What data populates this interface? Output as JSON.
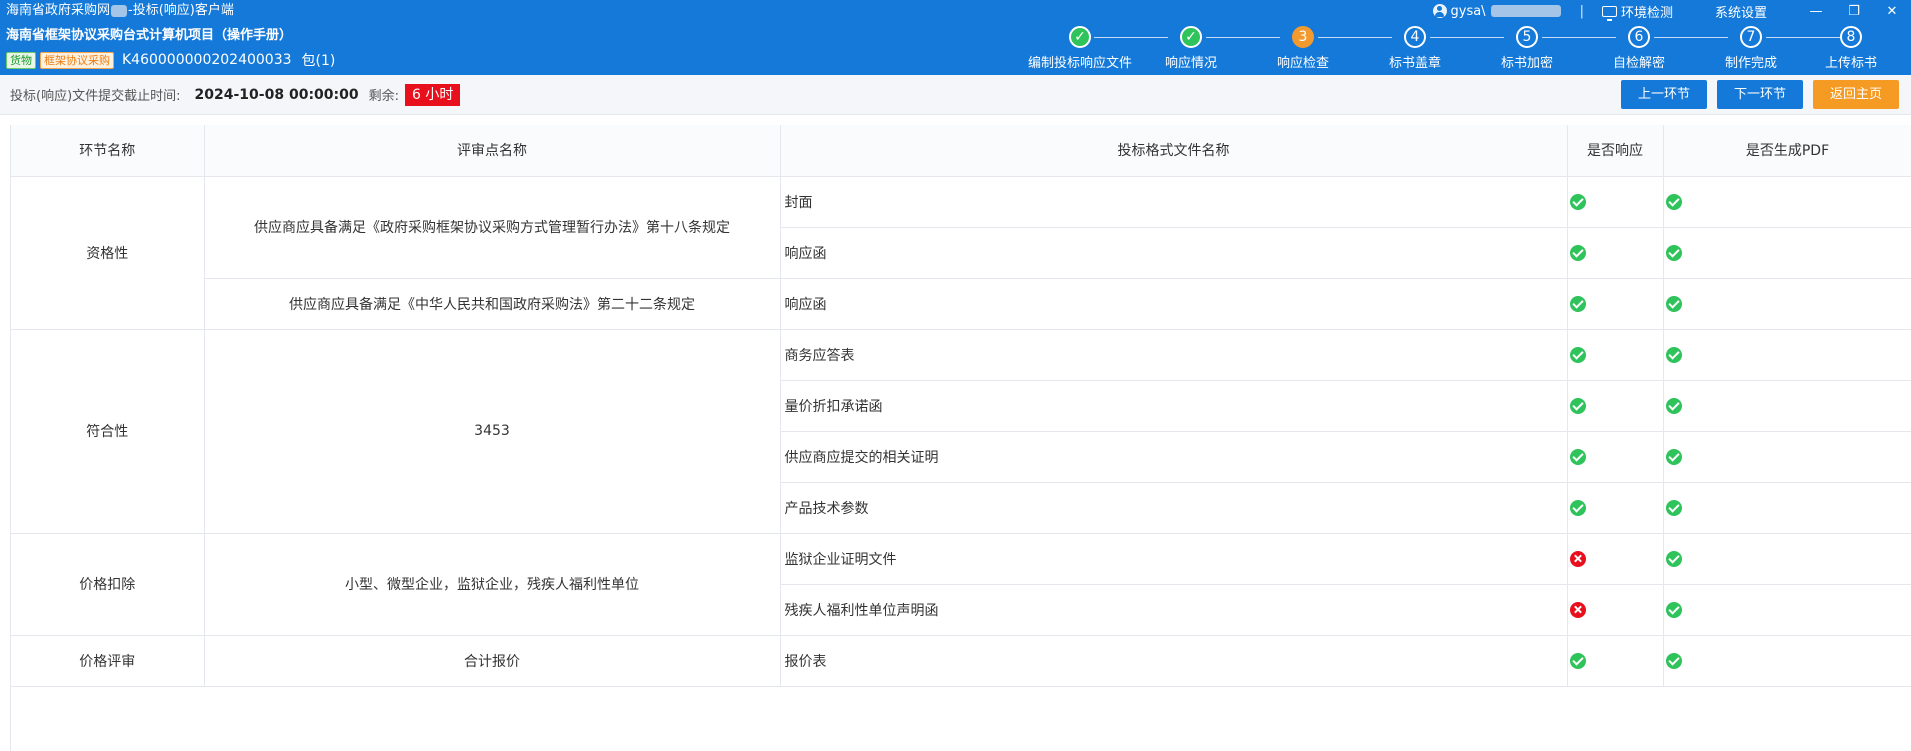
{
  "window": {
    "title_part1": "海南省政府采购网",
    "title_part2": "-投标(响应)客户端",
    "project_title": "海南省框架协议采购台式计算机项目（操作手册）",
    "tag_goods": "货物",
    "tag_mode": "框架协议采购",
    "project_code": "K460000000202400033",
    "package": "包(1)",
    "user": "gysa\\",
    "env_check": "环境检测",
    "settings": "系统设置",
    "separator": "|"
  },
  "steps": [
    {
      "number": "✓",
      "label": "编制投标响应文件",
      "status": "done"
    },
    {
      "number": "✓",
      "label": "响应情况",
      "status": "done"
    },
    {
      "number": "3",
      "label": "响应检查",
      "status": "current"
    },
    {
      "number": "4",
      "label": "标书盖章",
      "status": "pending"
    },
    {
      "number": "5",
      "label": "标书加密",
      "status": "pending"
    },
    {
      "number": "6",
      "label": "自检解密",
      "status": "pending"
    },
    {
      "number": "7",
      "label": "制作完成",
      "status": "pending"
    },
    {
      "number": "8",
      "label": "上传标书",
      "status": "pending"
    }
  ],
  "infobar": {
    "deadline_label": "投标(响应)文件提交截止时间:",
    "deadline_value": "2024-10-08 00:00:00",
    "remaining_label": "剩余:",
    "remaining_value": "6 小时",
    "prev_button": "上一环节",
    "next_button": "下一环节",
    "home_button": "返回主页"
  },
  "table": {
    "headers": [
      "环节名称",
      "评审点名称",
      "投标格式文件名称",
      "是否响应",
      "是否生成PDF"
    ],
    "rows": [
      {
        "stage": "资格性",
        "point": "供应商应具备满足《政府采购框架协议采购方式管理暂行办法》第十八条规定",
        "file": "封面",
        "responded": true,
        "pdf": true
      },
      {
        "stage": "资格性",
        "point": "供应商应具备满足《政府采购框架协议采购方式管理暂行办法》第十八条规定",
        "file": "响应函",
        "responded": true,
        "pdf": true
      },
      {
        "stage": "资格性",
        "point": "供应商应具备满足《中华人民共和国政府采购法》第二十二条规定",
        "file": "响应函",
        "responded": true,
        "pdf": true
      },
      {
        "stage": "符合性",
        "point": "3453",
        "file": "商务应答表",
        "responded": true,
        "pdf": true
      },
      {
        "stage": "符合性",
        "point": "3453",
        "file": "量价折扣承诺函",
        "responded": true,
        "pdf": true
      },
      {
        "stage": "符合性",
        "point": "3453",
        "file": "供应商应提交的相关证明",
        "responded": true,
        "pdf": true
      },
      {
        "stage": "符合性",
        "point": "3453",
        "file": "产品技术参数",
        "responded": true,
        "pdf": true
      },
      {
        "stage": "价格扣除",
        "point": "小型、微型企业，监狱企业，残疾人福利性单位",
        "file": "监狱企业证明文件",
        "responded": false,
        "pdf": true
      },
      {
        "stage": "价格扣除",
        "point": "小型、微型企业，监狱企业，残疾人福利性单位",
        "file": "残疾人福利性单位声明函",
        "responded": false,
        "pdf": true
      },
      {
        "stage": "价格评审",
        "point": "合计报价",
        "file": "报价表",
        "responded": true,
        "pdf": true
      }
    ]
  },
  "colors": {
    "header_blue": "#1479d8",
    "step_done": "#2fc35b",
    "step_current": "#f39a2e",
    "ok_green": "#2fc35b",
    "error_red": "#e8101d",
    "orange_button": "#f59a23"
  },
  "icons": {
    "user": "user-icon",
    "env": "monitor-icon",
    "ok": "check-circle-icon",
    "error": "x-circle-icon"
  }
}
